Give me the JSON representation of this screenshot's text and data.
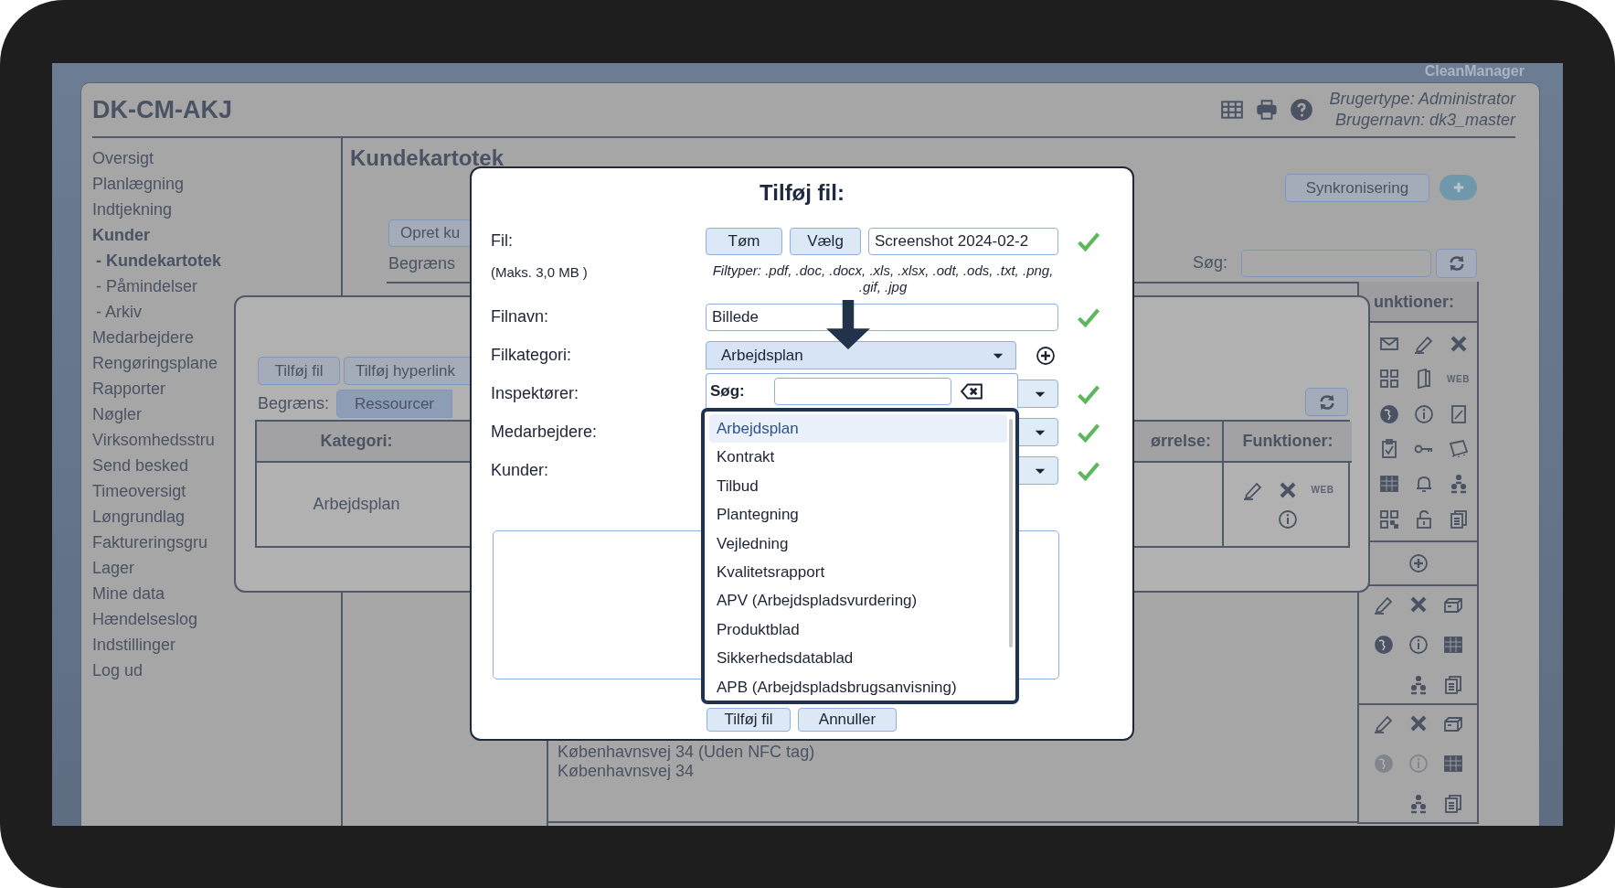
{
  "brand": "CleanManager",
  "app": {
    "title": "DK-CM-AKJ",
    "user_lines": [
      "Brugertype: Administrator",
      "Brugernavn: dk3_master"
    ]
  },
  "sidebar": {
    "items": [
      {
        "label": "Oversigt",
        "selected": false
      },
      {
        "label": "Planlægning",
        "selected": false
      },
      {
        "label": "Indtjekning",
        "selected": false
      },
      {
        "label": "Kunder",
        "selected": true,
        "children": [
          {
            "label": "- Kundekartotek",
            "selected": true
          },
          {
            "label": "- Påmindelser",
            "selected": false
          },
          {
            "label": "- Arkiv",
            "selected": false
          }
        ]
      },
      {
        "label": "Medarbejdere",
        "selected": false
      },
      {
        "label": "Rengøringsplane",
        "selected": false
      },
      {
        "label": "Rapporter",
        "selected": false
      },
      {
        "label": "Nøgler",
        "selected": false
      },
      {
        "label": "Virksomhedsstru",
        "selected": false
      },
      {
        "label": "Send besked",
        "selected": false
      },
      {
        "label": "Timeoversigt",
        "selected": false
      },
      {
        "label": "Løngrundlag",
        "selected": false
      },
      {
        "label": "Faktureringsgru",
        "selected": false
      },
      {
        "label": "Lager",
        "selected": false
      },
      {
        "label": "Mine data",
        "selected": false
      },
      {
        "label": "Hændelseslog",
        "selected": false
      },
      {
        "label": "Indstillinger",
        "selected": false
      },
      {
        "label": "Log ud",
        "selected": false
      }
    ]
  },
  "page": {
    "heading": "Kundekartotek",
    "sync_button": "Synkronisering",
    "create_button": "Opret ku",
    "filter_label": "Begræns",
    "search_label": "Søg:",
    "functions_header": "unktioner:",
    "function_rows": [
      {
        "kind": "full",
        "web_label": "WEB"
      },
      {
        "kind": "add"
      },
      {
        "kind": "compact",
        "disabled": false
      },
      {
        "kind": "compact",
        "disabled": true
      }
    ],
    "address_lines": [
      "Københavnsvej 34 (Uden NFC tag)",
      "Københavnsvej 34"
    ]
  },
  "files_panel": {
    "buttons": [
      "Tilføj fil",
      "Tilføj hyperlink"
    ],
    "filter_label": "Begræns:",
    "filter_tabs": [
      {
        "label": "Ressourcer",
        "selected": true
      }
    ],
    "columns": [
      "Kategori:",
      "ørrelse:",
      "Funktioner:"
    ],
    "rows": [
      {
        "category": "Arbejdsplan",
        "web_label": "WEB"
      }
    ]
  },
  "dialog": {
    "title": "Tilføj fil:",
    "file": {
      "label": "Fil:",
      "note": "(Maks. 3,0 MB )",
      "clear_button": "Tøm",
      "choose_button": "Vælg",
      "value": "Screenshot 2024-02-2",
      "valid": true,
      "types": "Filtyper: .pdf, .doc, .docx, .xls, .xlsx, .odt, .ods, .txt, .png, .gif, .jpg"
    },
    "fields": [
      {
        "kind": "text",
        "label": "Filnavn:",
        "value": "Billede",
        "valid": true
      },
      {
        "kind": "category",
        "label": "Filkategori:",
        "value": "Arbejdsplan",
        "expanded": true
      },
      {
        "kind": "select",
        "label": "Inspektører:",
        "valid": true
      },
      {
        "kind": "select",
        "label": "Medarbejdere:",
        "valid": true
      },
      {
        "kind": "select",
        "label": "Kunder:",
        "valid": true
      }
    ],
    "dropdown": {
      "search_label": "Søg:",
      "options": [
        {
          "label": "Arbejdsplan",
          "selected": true
        },
        {
          "label": "Kontrakt",
          "selected": false
        },
        {
          "label": "Tilbud",
          "selected": false
        },
        {
          "label": "Plantegning",
          "selected": false
        },
        {
          "label": "Vejledning",
          "selected": false
        },
        {
          "label": "Kvalitetsrapport",
          "selected": false
        },
        {
          "label": "APV (Arbejdspladsvurdering)",
          "selected": false
        },
        {
          "label": "Produktblad",
          "selected": false
        },
        {
          "label": "Sikkerhedsdatablad",
          "selected": false
        },
        {
          "label": "APB (Arbejdspladsbrugsanvisning)",
          "selected": false
        }
      ]
    },
    "buttons": [
      "Tilføj fil",
      "Annuller"
    ]
  }
}
